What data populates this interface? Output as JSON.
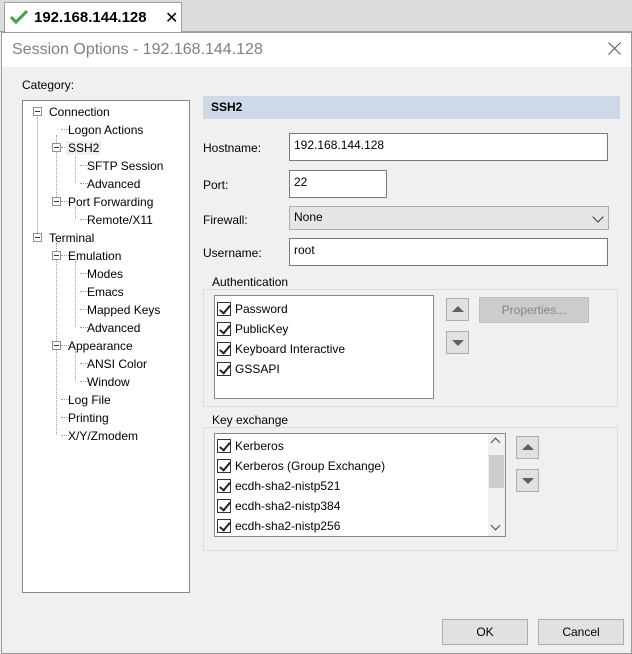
{
  "tab": {
    "title": "192.168.144.128",
    "close": "✕",
    "status_icon": "check-icon"
  },
  "dialog": {
    "title": "Session Options - 192.168.144.128",
    "category_label": "Category:",
    "tree": [
      {
        "label": "Connection"
      },
      {
        "label": "Logon Actions"
      },
      {
        "label": "SSH2"
      },
      {
        "label": "SFTP Session"
      },
      {
        "label": "Advanced"
      },
      {
        "label": "Port Forwarding"
      },
      {
        "label": "Remote/X11"
      },
      {
        "label": "Terminal"
      },
      {
        "label": "Emulation"
      },
      {
        "label": "Modes"
      },
      {
        "label": "Emacs"
      },
      {
        "label": "Mapped Keys"
      },
      {
        "label": "Advanced"
      },
      {
        "label": "Appearance"
      },
      {
        "label": "ANSI Color"
      },
      {
        "label": "Window"
      },
      {
        "label": "Log File"
      },
      {
        "label": "Printing"
      },
      {
        "label": "X/Y/Zmodem"
      }
    ],
    "panel": {
      "header": "SSH2",
      "hostname_label": "Hostname:",
      "hostname_value": "192.168.144.128",
      "port_label": "Port:",
      "port_value": "22",
      "firewall_label": "Firewall:",
      "firewall_value": "None",
      "username_label": "Username:",
      "username_value": "root",
      "auth_group": "Authentication",
      "auth_items": [
        {
          "label": "Password",
          "checked": true
        },
        {
          "label": "PublicKey",
          "checked": true
        },
        {
          "label": "Keyboard Interactive",
          "checked": true
        },
        {
          "label": "GSSAPI",
          "checked": true
        }
      ],
      "properties_button": "Properties...",
      "kex_group": "Key exchange",
      "kex_items": [
        {
          "label": "Kerberos",
          "checked": true
        },
        {
          "label": "Kerberos (Group Exchange)",
          "checked": true
        },
        {
          "label": "ecdh-sha2-nistp521",
          "checked": true
        },
        {
          "label": "ecdh-sha2-nistp384",
          "checked": true
        },
        {
          "label": "ecdh-sha2-nistp256",
          "checked": true
        }
      ]
    },
    "ok_button": "OK",
    "cancel_button": "Cancel"
  }
}
